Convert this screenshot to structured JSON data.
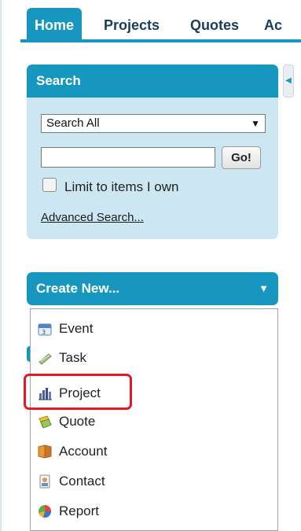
{
  "tabs": [
    {
      "label": "Home",
      "active": true
    },
    {
      "label": "Projects",
      "active": false
    },
    {
      "label": "Quotes",
      "active": false
    },
    {
      "label": "Ac",
      "active": false
    }
  ],
  "search": {
    "title": "Search",
    "scope_value": "Search All",
    "query_value": "",
    "go_label": "Go!",
    "limit_label": "Limit to items I own",
    "advanced_link": "Advanced Search..."
  },
  "create_new": {
    "title": "Create New...",
    "items": [
      {
        "label": "Event",
        "icon": "calendar-icon"
      },
      {
        "label": "Task",
        "icon": "task-icon"
      },
      {
        "label": "Project",
        "icon": "project-chart-icon"
      },
      {
        "label": "Quote",
        "icon": "quote-icon"
      },
      {
        "label": "Account",
        "icon": "account-folder-icon"
      },
      {
        "label": "Contact",
        "icon": "contact-card-icon"
      },
      {
        "label": "Report",
        "icon": "report-pie-icon"
      }
    ]
  },
  "colors": {
    "accent": "#1797c0",
    "panel": "#cde7f2",
    "highlight": "#e01b24"
  }
}
